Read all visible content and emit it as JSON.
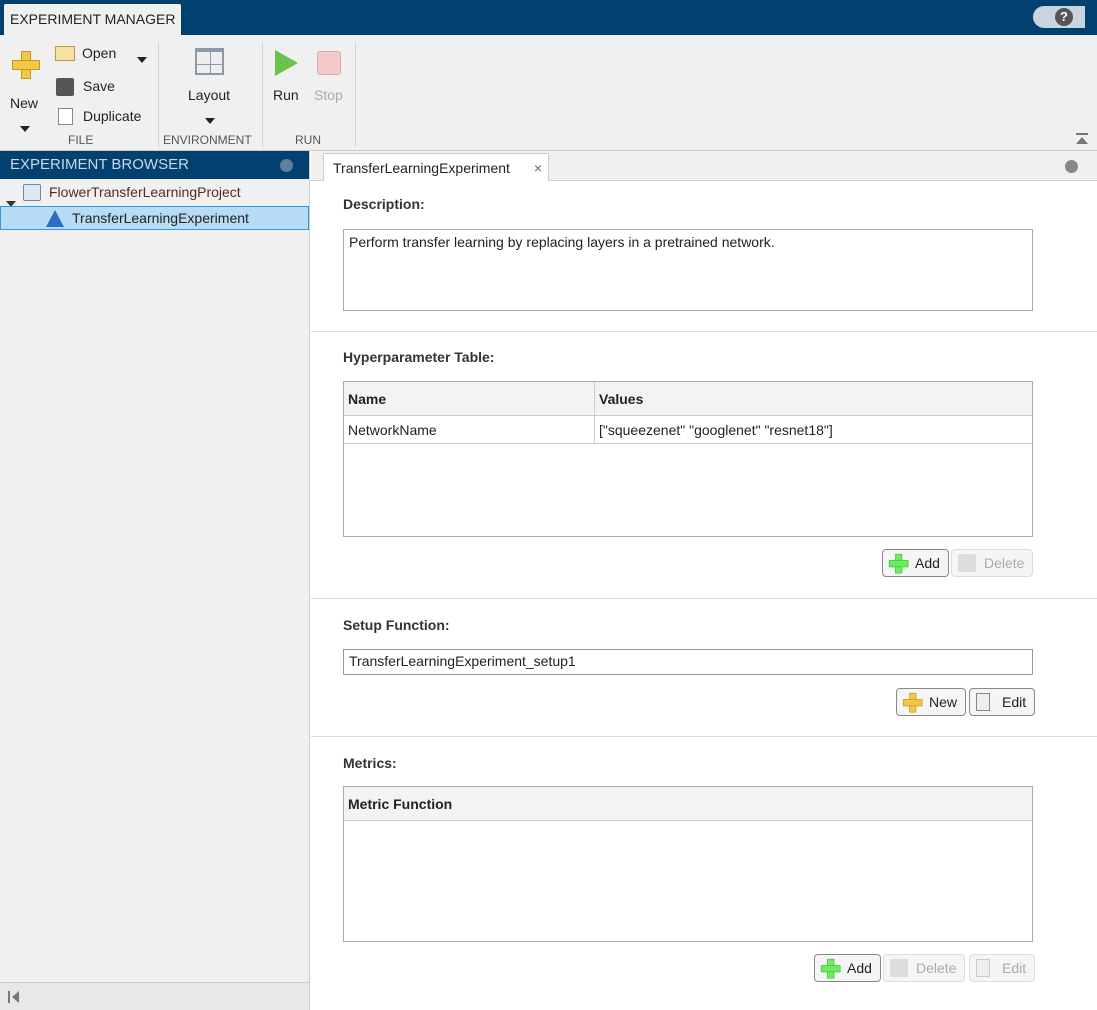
{
  "app": {
    "tab": "EXPERIMENT MANAGER",
    "help": "?"
  },
  "ribbon": {
    "new": "New",
    "open": "Open",
    "save": "Save",
    "duplicate": "Duplicate",
    "layout": "Layout",
    "run": "Run",
    "stop": "Stop",
    "sections": {
      "file": "FILE",
      "environment": "ENVIRONMENT",
      "run": "RUN"
    }
  },
  "browser": {
    "title": "EXPERIMENT BROWSER",
    "project": "FlowerTransferLearningProject",
    "experiment": "TransferLearningExperiment"
  },
  "doc": {
    "tab": "TransferLearningExperiment",
    "close": "×",
    "description": {
      "label": "Description:",
      "value": "Perform transfer learning by replacing layers in a pretrained network."
    },
    "hyper": {
      "label": "Hyperparameter Table:",
      "headers": [
        "Name",
        "Values"
      ],
      "rows": [
        [
          "NetworkName",
          "[\"squeezenet\" \"googlenet\" \"resnet18\"]"
        ]
      ],
      "add": "Add",
      "delete": "Delete"
    },
    "setup": {
      "label": "Setup Function:",
      "value": "TransferLearningExperiment_setup1",
      "new": "New",
      "edit": "Edit"
    },
    "metrics": {
      "label": "Metrics:",
      "header": "Metric Function",
      "add": "Add",
      "delete": "Delete",
      "edit": "Edit"
    }
  }
}
